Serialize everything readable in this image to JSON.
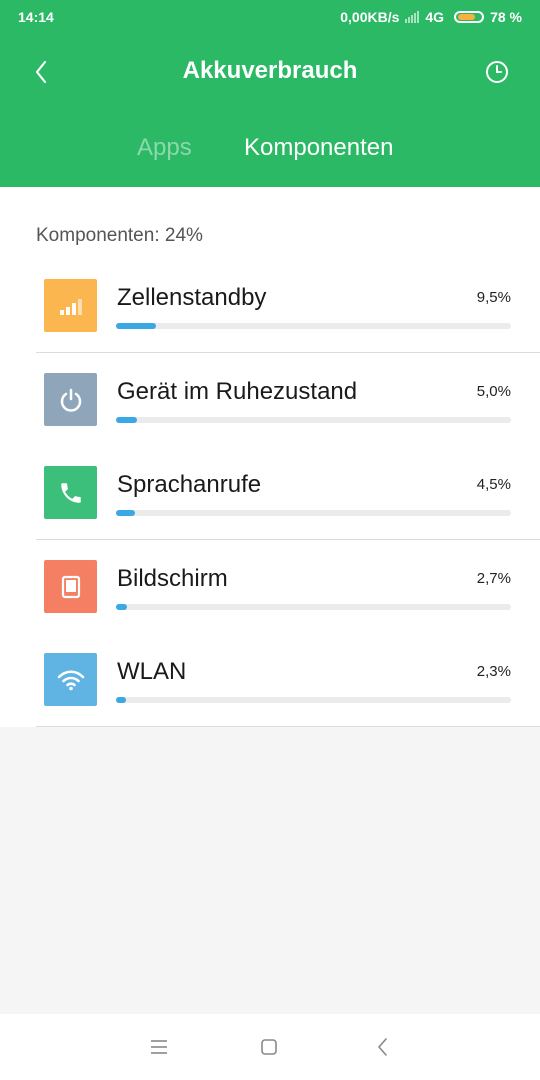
{
  "status_bar": {
    "time": "14:14",
    "network_speed": "0,00KB/s",
    "network_type": "4G",
    "battery_percent": "78 %",
    "battery_level": 0.78
  },
  "header": {
    "title": "Akkuverbrauch",
    "back_icon": "chevron-left-icon",
    "history_icon": "clock-icon",
    "background": "#2bb966"
  },
  "tabs": [
    {
      "label": "Apps",
      "active": false
    },
    {
      "label": "Komponenten",
      "active": true
    }
  ],
  "summary": "Komponenten: 24%",
  "items": [
    {
      "label": "Zellenstandby",
      "value": "9,5%",
      "fraction": 0.095,
      "icon": "signal-icon",
      "color": "#fbb650"
    },
    {
      "label": "Gerät im Ruhezustand",
      "value": "5,0%",
      "fraction": 0.05,
      "icon": "power-icon",
      "color": "#8fa6ba"
    },
    {
      "label": "Sprachanrufe",
      "value": "4,5%",
      "fraction": 0.045,
      "icon": "phone-icon",
      "color": "#3cbf7a"
    },
    {
      "label": "Bildschirm",
      "value": "2,7%",
      "fraction": 0.027,
      "icon": "screen-icon",
      "color": "#f57f62"
    },
    {
      "label": "WLAN",
      "value": "2,3%",
      "fraction": 0.023,
      "icon": "wifi-icon",
      "color": "#5fb4e4"
    }
  ],
  "bar_color": "#3aa8e4",
  "nav": {
    "menu_icon": "menu-icon",
    "home_icon": "home-icon",
    "back_icon": "back-icon"
  }
}
